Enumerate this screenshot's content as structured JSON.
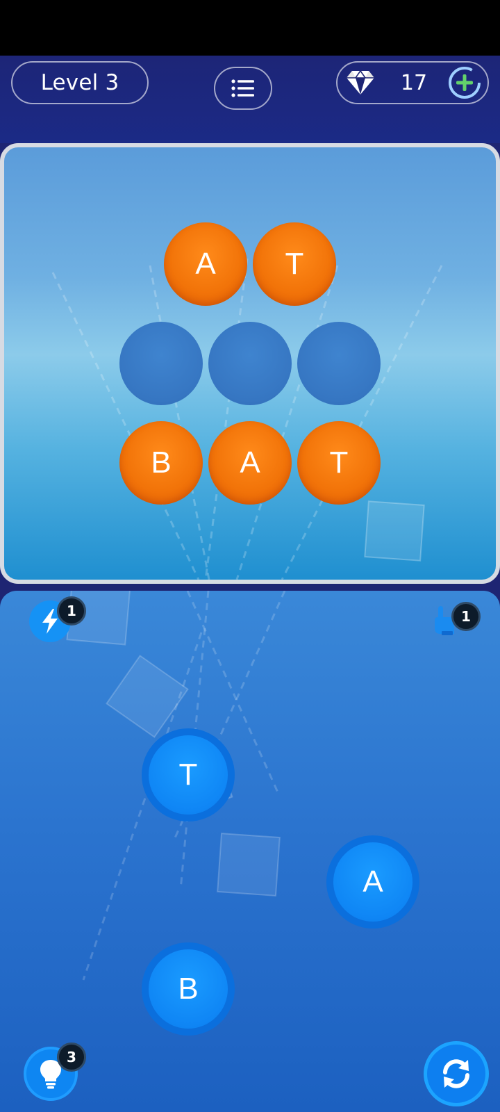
{
  "header": {
    "level_label": "Level 3",
    "gem_count": "17"
  },
  "board": {
    "rows": [
      [
        {
          "letter": "A",
          "state": "filled"
        },
        {
          "letter": "T",
          "state": "filled"
        }
      ],
      [
        {
          "letter": "",
          "state": "empty"
        },
        {
          "letter": "",
          "state": "empty"
        },
        {
          "letter": "",
          "state": "empty"
        }
      ],
      [
        {
          "letter": "B",
          "state": "filled"
        },
        {
          "letter": "A",
          "state": "filled"
        },
        {
          "letter": "T",
          "state": "filled"
        }
      ]
    ]
  },
  "wheel": {
    "letters": [
      "T",
      "A",
      "B"
    ]
  },
  "boosters": {
    "lightning_count": "1",
    "hand_count": "1",
    "hint_count": "3"
  },
  "icons": {
    "menu": "list-icon",
    "gem": "diamond-icon",
    "add": "plus-circle-icon",
    "lightning": "lightning-icon",
    "hand": "pointing-hand-icon",
    "hint": "lightbulb-icon",
    "refresh": "refresh-icon"
  },
  "colors": {
    "header_bg": "#1e2573",
    "tile_filled": "#f27409",
    "tile_empty": "#3676c2",
    "wheel_letter": "#0f86f5"
  }
}
